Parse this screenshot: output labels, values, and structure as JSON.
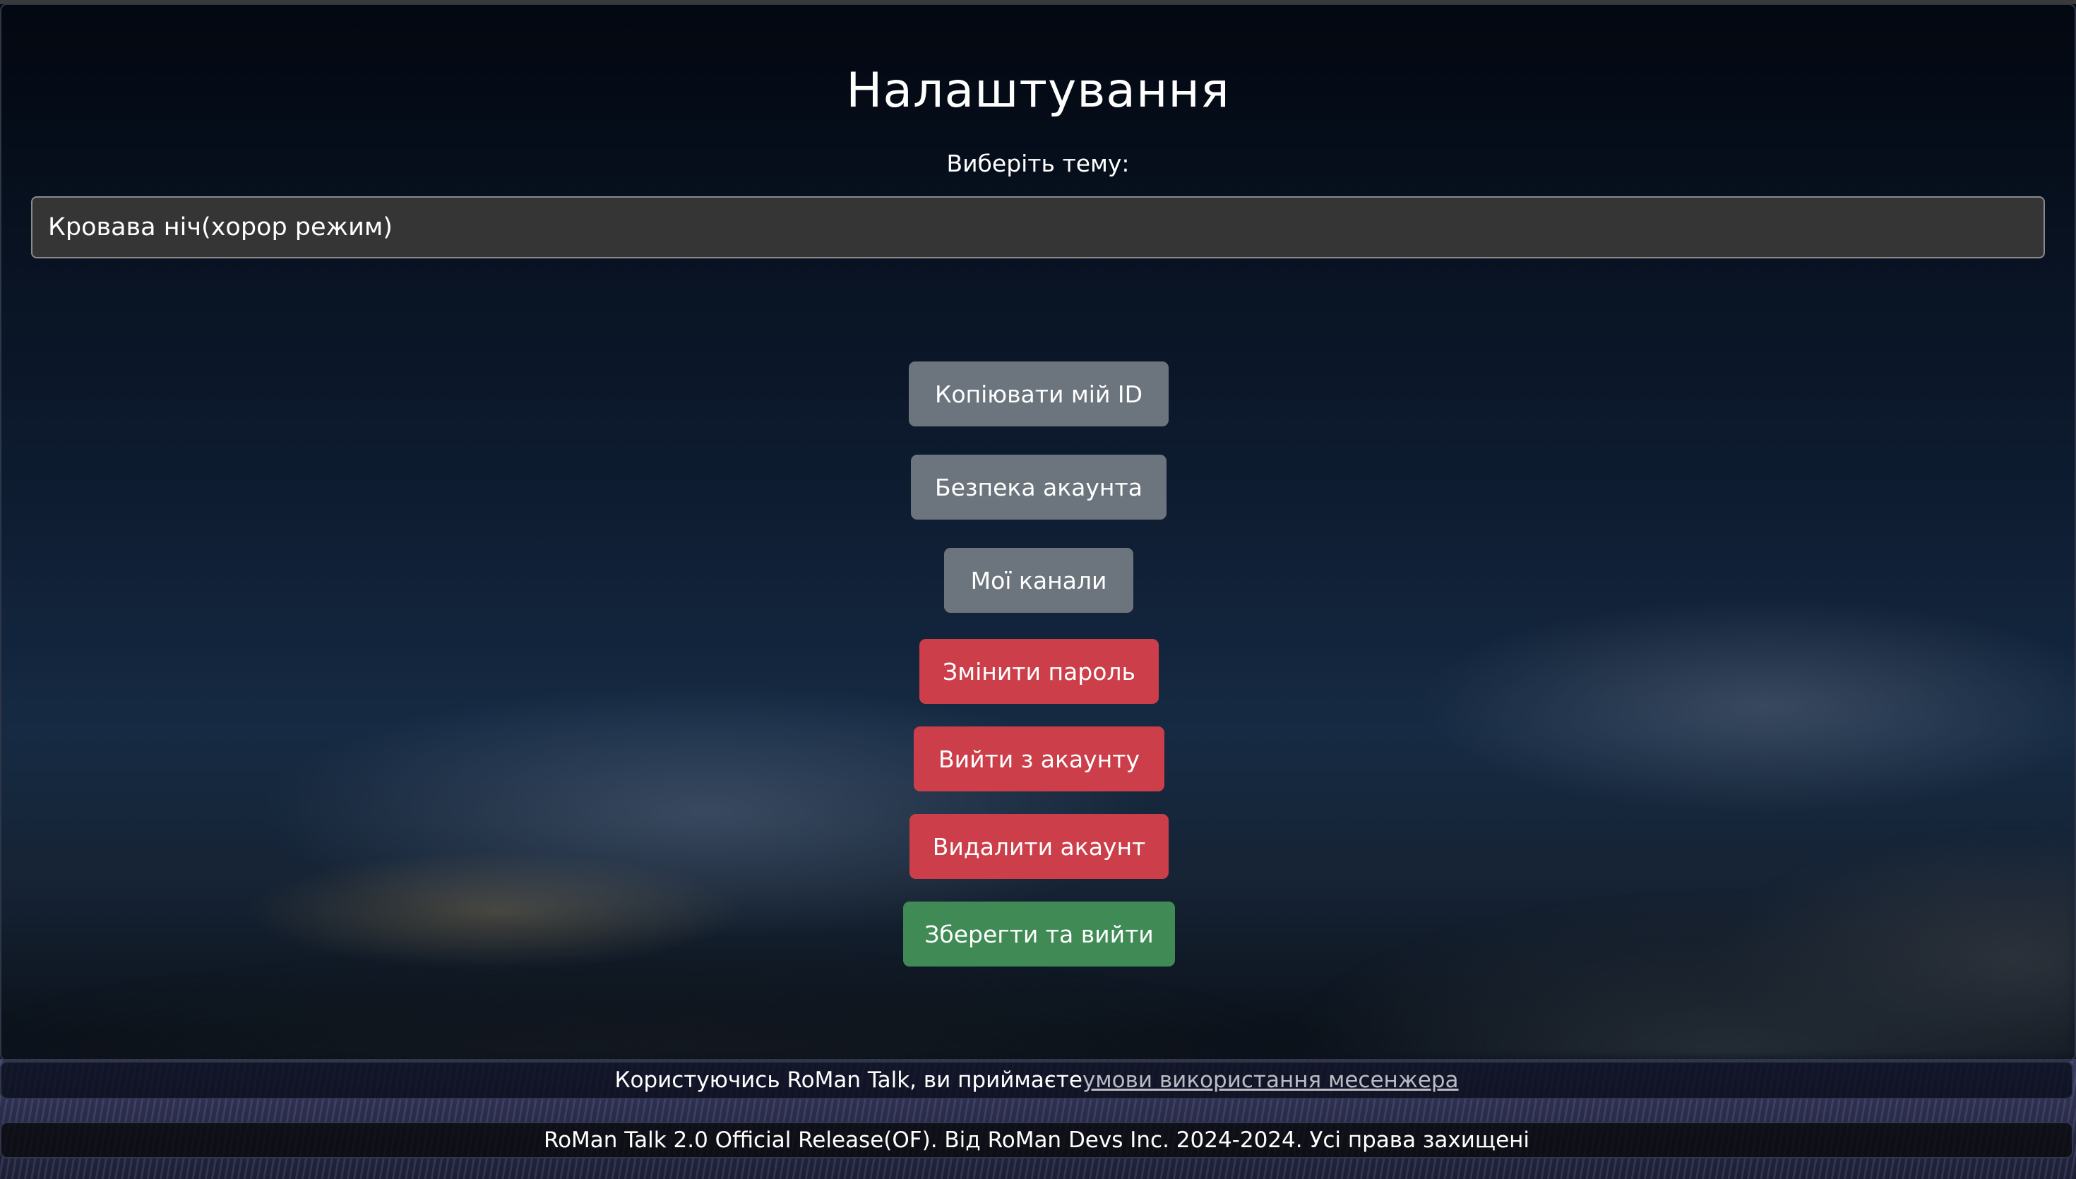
{
  "page": {
    "title": "Налаштування",
    "theme_label": "Виберіть тему:"
  },
  "theme_select": {
    "selected": "Кровава ніч(хорор режим)"
  },
  "buttons": {
    "copy_id": "Копіювати мій ID",
    "account_security": "Безпека акаунта",
    "my_channels": "Мої канали",
    "change_password": "Змінити пароль",
    "logout": "Вийти з акаунту",
    "delete_account": "Видалити акаунт",
    "save_exit": "Зберегти та вийти"
  },
  "footer": {
    "terms_prefix": "Користуючись RoMan Talk, ви приймаєте",
    "terms_link": "умови використання месенжера",
    "copyright": "RoMan Talk 2.0 Official Release(OF). Від RoMan Devs Inc. 2024-2024. Усі права захищені"
  },
  "colors": {
    "button_gray": "#6c757d",
    "button_red": "#cc3f4a",
    "button_green": "#3f8a55",
    "select_bg": "#353535"
  }
}
